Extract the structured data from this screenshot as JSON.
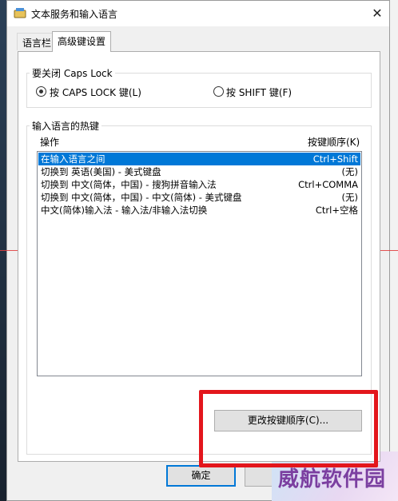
{
  "window": {
    "title": "文本服务和输入语言",
    "close_glyph": "✕"
  },
  "tabs": [
    {
      "label": "语言栏"
    },
    {
      "label": "高级键设置"
    }
  ],
  "caps_lock": {
    "legend": "要关闭 Caps Lock",
    "options": [
      {
        "label": "按 CAPS LOCK 键(L)",
        "selected": true
      },
      {
        "label": "按 SHIFT 键(F)",
        "selected": false
      }
    ]
  },
  "hotkeys": {
    "legend": "输入语言的热键",
    "col_action": "操作",
    "col_sequence": "按键顺序(K)",
    "rows": [
      {
        "action": "在输入语言之间",
        "keys": "Ctrl+Shift",
        "selected": true
      },
      {
        "action": "切换到 英语(美国) - 美式键盘",
        "keys": "(无)",
        "selected": false
      },
      {
        "action": "切换到 中文(简体，中国) - 搜狗拼音输入法",
        "keys": "Ctrl+COMMA",
        "selected": false
      },
      {
        "action": "切换到 中文(简体，中国) - 中文(简体) - 美式键盘",
        "keys": "(无)",
        "selected": false
      },
      {
        "action": "中文(简体)输入法 - 输入法/非输入法切换",
        "keys": "Ctrl+空格",
        "selected": false
      }
    ],
    "change_button": "更改按键顺序(C)..."
  },
  "footer": {
    "ok": "确定",
    "cancel_partial": "取"
  },
  "watermark": "威航软件园",
  "colors": {
    "selection": "#0078d7",
    "highlight_box": "#e3161c"
  }
}
